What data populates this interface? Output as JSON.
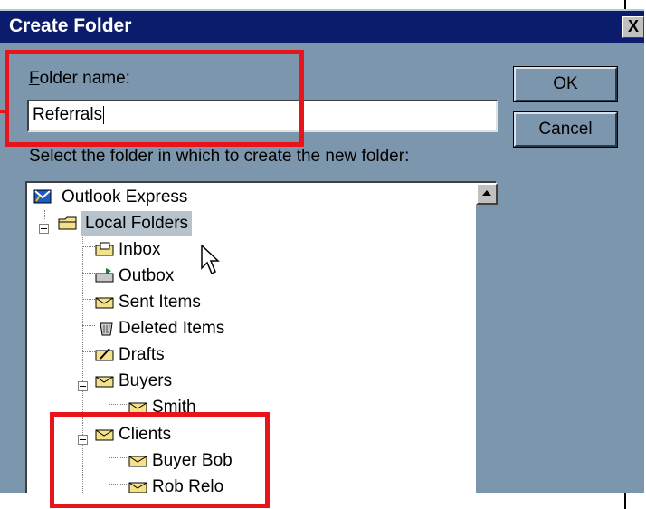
{
  "dialog": {
    "title": "Create Folder",
    "close_glyph": "X",
    "folder_name_label_first": "F",
    "folder_name_label_rest": "older name:",
    "folder_name_value": "Referrals",
    "select_label": "Select the folder in which to create the new folder:",
    "ok_label": "OK",
    "cancel_label": "Cancel"
  },
  "tree": {
    "root": "Outlook Express",
    "local_folders": "Local Folders",
    "inbox": "Inbox",
    "outbox": "Outbox",
    "sent_items": "Sent Items",
    "deleted_items": "Deleted Items",
    "drafts": "Drafts",
    "buyers": "Buyers",
    "smith": "Smith",
    "clients": "Clients",
    "buyer_bob": "Buyer Bob",
    "rob_relo": "Rob Relo"
  },
  "colors": {
    "dialog_bg": "#7c97ad",
    "titlebar": "#0c1c6c",
    "highlight_box": "#e8141c",
    "selection": "#b6c2cc"
  },
  "icons": {
    "root": "outlook-express-icon",
    "folder": "envelope-folder-icon",
    "expand": "minus-box-icon",
    "pointer": "mouse-pointer-icon"
  }
}
